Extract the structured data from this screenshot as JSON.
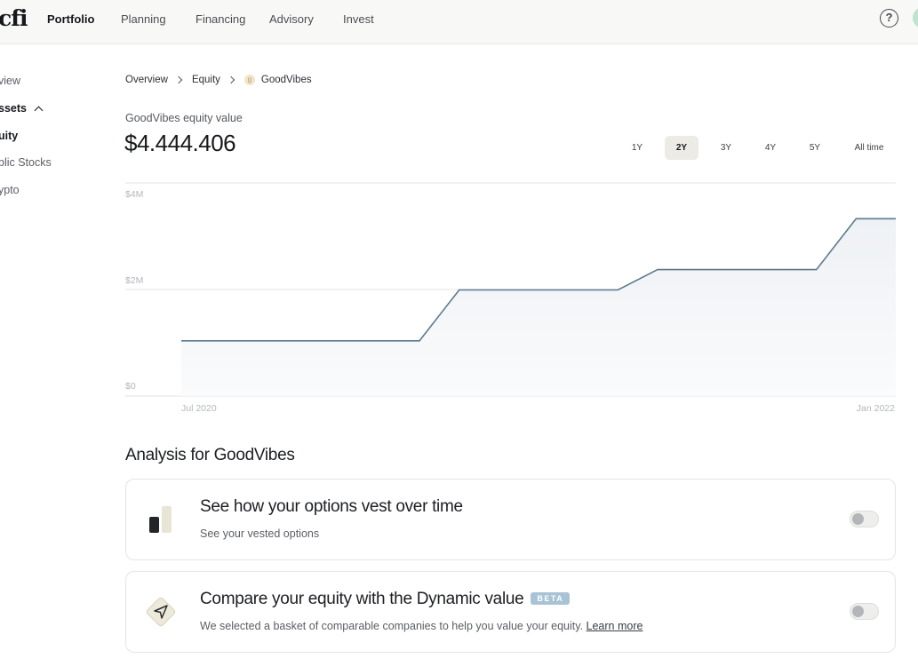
{
  "brand": {
    "logo_text": "cfi"
  },
  "topnav": {
    "items": [
      {
        "label": "Portfolio",
        "active": true
      },
      {
        "label": "Planning",
        "active": false
      },
      {
        "label": "Financing",
        "active": false
      },
      {
        "label": "Advisory",
        "active": false
      },
      {
        "label": "Invest",
        "active": false
      }
    ],
    "help_glyph": "?"
  },
  "sidebar": {
    "items": [
      {
        "label": "view"
      },
      {
        "label": "ssets"
      },
      {
        "label": "uity"
      },
      {
        "label": "blic Stocks"
      },
      {
        "label": "ypto"
      }
    ]
  },
  "breadcrumb": {
    "items": [
      "Overview",
      "Equity",
      "GoodVibes"
    ],
    "company_logo_glyph": "g"
  },
  "equity": {
    "label": "GoodVibes equity value",
    "amount": "$4.444.406"
  },
  "range_selector": {
    "options": [
      "1Y",
      "2Y",
      "3Y",
      "4Y",
      "5Y",
      "All time"
    ],
    "selected": "2Y"
  },
  "chart_data": {
    "type": "area",
    "title": "",
    "xlabel": "",
    "ylabel": "",
    "y_tick_labels": [
      "$4M",
      "$2M",
      "$0"
    ],
    "x_tick_labels": [
      "Jul 2020",
      "Jan 2022"
    ],
    "ylim": [
      0,
      4000000
    ],
    "grid": true,
    "line_color": "#5a7a8c",
    "series": [
      {
        "x": [
          "2020-07",
          "2021-01",
          "2021-02",
          "2021-06",
          "2021-07",
          "2021-11",
          "2021-12",
          "2022-01"
        ],
        "values": [
          1000000,
          1000000,
          2000000,
          2000000,
          2400000,
          2400000,
          3400000,
          3400000
        ]
      }
    ]
  },
  "analysis": {
    "title": "Analysis for GoodVibes",
    "cards": [
      {
        "title": "See how your options vest over time",
        "subtitle": "See your vested options",
        "icon": "vesting-bars-icon",
        "toggle_on": false
      },
      {
        "title": "Compare your equity with the Dynamic value",
        "badge": "BETA",
        "subtitle": "We selected a basket of comparable companies to help you value your equity.",
        "link": "Learn more",
        "icon": "compass-diamond-icon",
        "toggle_on": false
      }
    ]
  }
}
